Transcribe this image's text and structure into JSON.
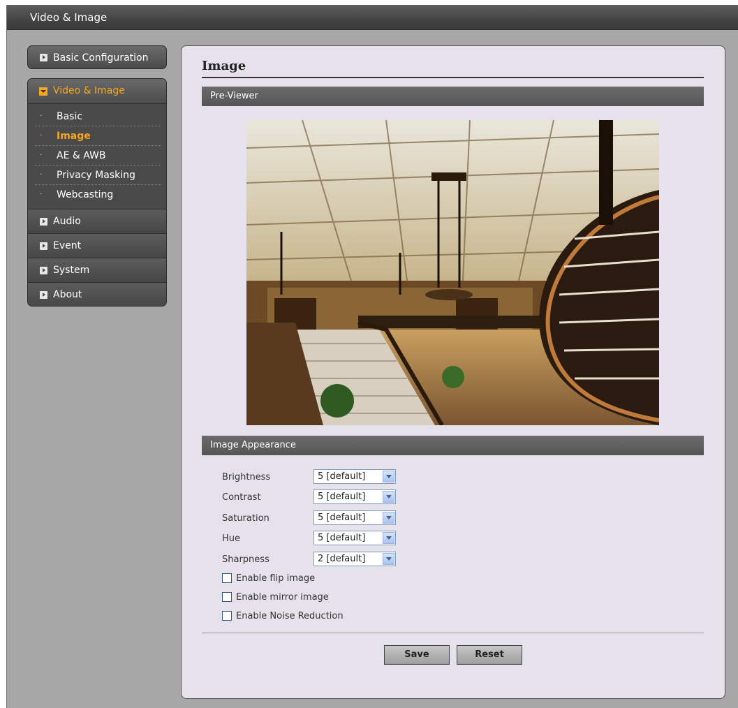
{
  "window": {
    "title": "Video & Image"
  },
  "sidebar": {
    "basic_config": "Basic Configuration",
    "active_group": {
      "label": "Video & Image",
      "items": [
        {
          "label": "Basic",
          "active": false
        },
        {
          "label": "Image",
          "active": true
        },
        {
          "label": "AE & AWB",
          "active": false
        },
        {
          "label": "Privacy Masking",
          "active": false
        },
        {
          "label": "Webcasting",
          "active": false
        }
      ]
    },
    "items": [
      {
        "label": "Audio"
      },
      {
        "label": "Event"
      },
      {
        "label": "System"
      },
      {
        "label": "About"
      }
    ]
  },
  "main": {
    "title": "Image",
    "preview_section": "Pre-Viewer",
    "appearance_section": "Image Appearance",
    "settings": [
      {
        "label": "Brightness",
        "value": "5 [default]"
      },
      {
        "label": "Contrast",
        "value": "5 [default]"
      },
      {
        "label": "Saturation",
        "value": "5 [default]"
      },
      {
        "label": "Hue",
        "value": "5 [default]"
      },
      {
        "label": "Sharpness",
        "value": "2 [default]"
      }
    ],
    "checkboxes": [
      {
        "label": "Enable flip image",
        "checked": false
      },
      {
        "label": "Enable mirror image",
        "checked": false
      },
      {
        "label": "Enable Noise Reduction",
        "checked": false
      }
    ],
    "save_label": "Save",
    "reset_label": "Reset"
  },
  "colors": {
    "accent": "#f5a623",
    "panel_bg": "#e6e2ec",
    "frame_bg": "#a7a7a7"
  }
}
